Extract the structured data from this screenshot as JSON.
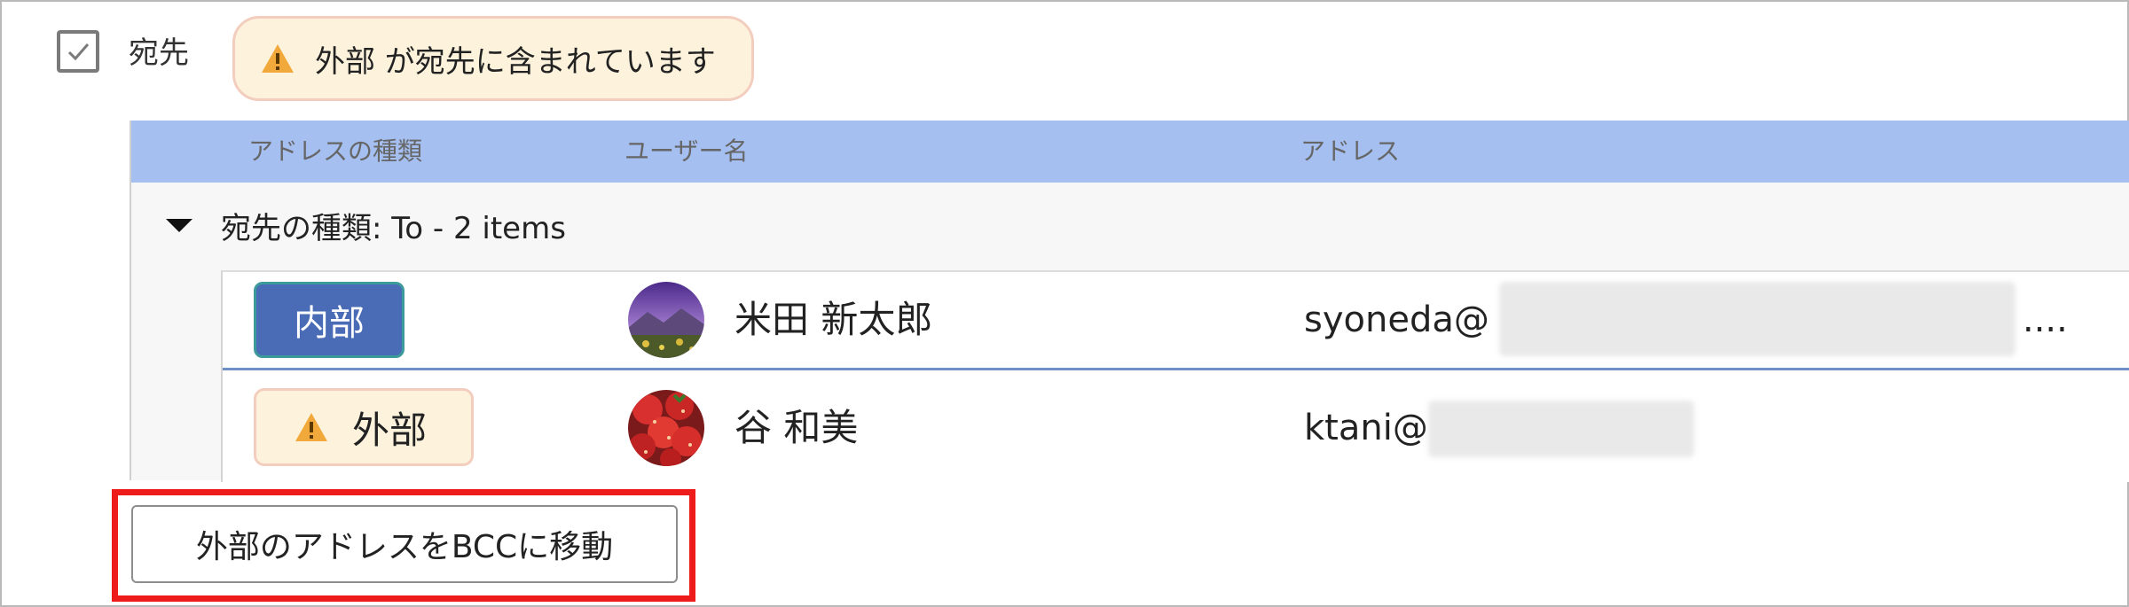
{
  "recipients": {
    "checkbox_label": "宛先",
    "warning_chip": "外部 が宛先に含まれています"
  },
  "grid": {
    "columns": [
      "アドレスの種類",
      "ユーザー名",
      "アドレス"
    ],
    "group_header": "宛先の種類: To - 2 items",
    "rows": [
      {
        "type_badge": "内部",
        "user_name": "米田 新太郎",
        "address_visible": "syoneda@",
        "address_ellipsis": "...."
      },
      {
        "type_badge": "外部",
        "user_name": "谷 和美",
        "address_visible": "ktani@"
      }
    ]
  },
  "actions": {
    "move_to_bcc_label": "外部のアドレスをBCCに移動"
  },
  "colors": {
    "header_bg": "#a4bff0",
    "internal_badge": "#4a6bb5",
    "external_badge_bg": "#fdf3dd",
    "warning_icon": "#f2a93b",
    "highlight_border": "#ee1b1b"
  },
  "icons": [
    "checkbox-checked-icon",
    "warning-icon",
    "collapse-arrow-icon",
    "avatar-mountain",
    "avatar-strawberries"
  ]
}
